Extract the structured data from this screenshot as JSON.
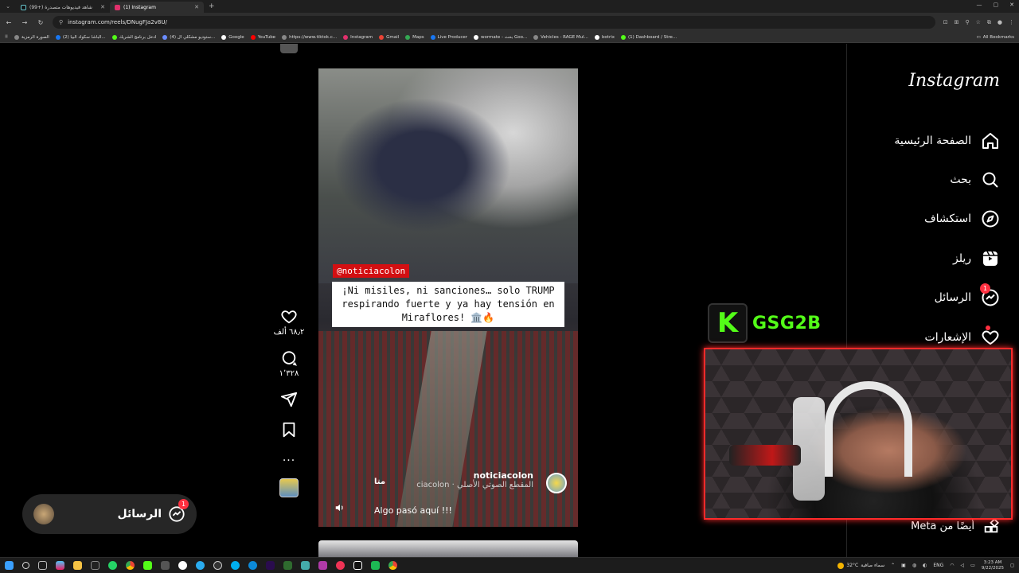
{
  "browser": {
    "tabs": [
      {
        "title": "(99+) شاهد فيديوهات متصدرة",
        "active": false,
        "favicon": "tiktok-icon"
      },
      {
        "title": "(1) Instagram",
        "active": true,
        "favicon": "instagram-icon"
      }
    ],
    "url": "instagram.com/reels/DNugFJa2v8U/",
    "bookmarks": [
      "الصورة الرمزية",
      "(2) الباشا سكواد البيا...",
      "ادخل برنامج الشريك",
      "(4) ستوديو مشكلي ال...",
      "Google",
      "YouTube",
      "https://www.tiktok.c...",
      "Instagram",
      "Gmail",
      "Maps",
      "Live Producer",
      "wormate - بحث Goo...",
      "Vehicles - RAGE Mul...",
      "botrix",
      "(1) Dashboard / Stre..."
    ],
    "all_bookmarks_label": "All Bookmarks"
  },
  "reel": {
    "handle_tag": "@noticiacolon",
    "caption_overlay": "¡Ni misiles, ni sanciones… solo TRUMP respirando fuerte y ya hay tensión en Miraflores! 🏛️🔥",
    "author_name": "noticiacolon",
    "author_sub": "ciacolon · المقطع الصوتي الأصلي",
    "follow_label": "متا",
    "caption": "Algo pasó aquí !!!",
    "likes": "٦٨٫٢ ألف",
    "comments": "١٬٣٢٨",
    "more_label": "..."
  },
  "sidebar": {
    "logo": "Instagram",
    "items": [
      {
        "label": "الصفحة الرئيسية",
        "icon": "home-icon"
      },
      {
        "label": "بحث",
        "icon": "search-icon"
      },
      {
        "label": "استكشاف",
        "icon": "compass-icon"
      },
      {
        "label": "ريلز",
        "icon": "reels-icon"
      },
      {
        "label": "الرسائل",
        "icon": "messenger-icon",
        "badge": "1"
      },
      {
        "label": "الإشعارات",
        "icon": "heart-icon"
      }
    ],
    "meta": "أيضًا من Meta"
  },
  "messages_pill": {
    "label": "الرسائل",
    "badge": "1"
  },
  "stream_overlay": {
    "tag": "GSG2B",
    "logo_letter": "K"
  },
  "taskbar": {
    "weather": "32°C",
    "weather_desc": "سماء صافية",
    "lang": "ENG",
    "time": "3:23 AM",
    "date": "9/22/2025"
  }
}
